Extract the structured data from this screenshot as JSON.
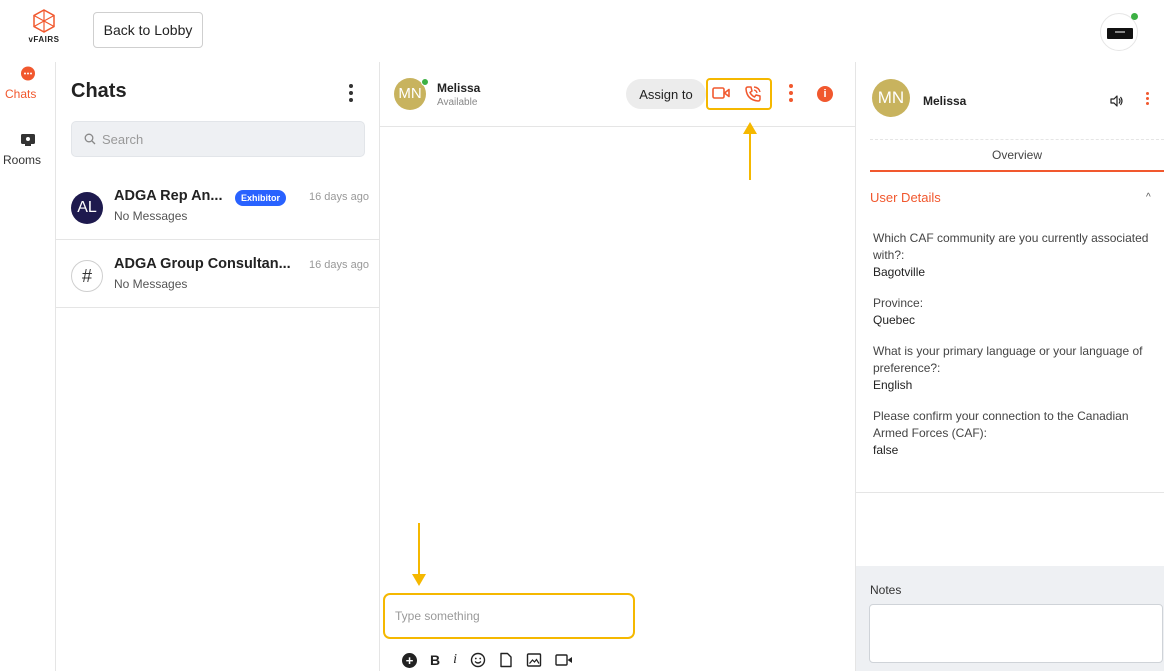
{
  "app": {
    "logo_text": "vFAIRS"
  },
  "topbar": {
    "back_label": "Back to Lobby"
  },
  "rail": {
    "items": [
      {
        "label": "Chats",
        "icon": "chat-bubble-icon"
      },
      {
        "label": "Rooms",
        "icon": "rooms-icon"
      }
    ]
  },
  "chats": {
    "title": "Chats",
    "search_placeholder": "Search",
    "items": [
      {
        "avatar": "AL",
        "name": "ADGA Rep An...",
        "badge": "Exhibitor",
        "time": "16 days ago",
        "sub": "No Messages"
      },
      {
        "avatar": "#",
        "name": "ADGA Group Consultan...",
        "time": "16 days ago",
        "sub": "No Messages"
      }
    ]
  },
  "conversation": {
    "avatar": "MN",
    "name": "Melissa",
    "status": "Available",
    "assign_label": "Assign to",
    "info_symbol": "i",
    "composer_placeholder": "Type something",
    "toolbar": {
      "plus": "+",
      "bold": "B",
      "italic": "i"
    }
  },
  "profile": {
    "avatar": "MN",
    "name": "Melissa",
    "tab": "Overview",
    "section_title": "User Details",
    "details": [
      {
        "q": "Which CAF community are you currently associated with?:",
        "a": "Bagotville"
      },
      {
        "q": "Province:",
        "a": "Quebec"
      },
      {
        "q": "What is your primary language or your language of preference?:",
        "a": "English"
      },
      {
        "q": "Please confirm your connection to the Canadian Armed Forces (CAF):",
        "a": "false"
      }
    ],
    "notes_label": "Notes"
  },
  "colors": {
    "accent": "#f1582e",
    "highlight": "#f5b800",
    "online": "#3cb043",
    "badge": "#2962ff",
    "avatar_mn": "#c8b35e",
    "avatar_al": "#1e1a4e"
  }
}
